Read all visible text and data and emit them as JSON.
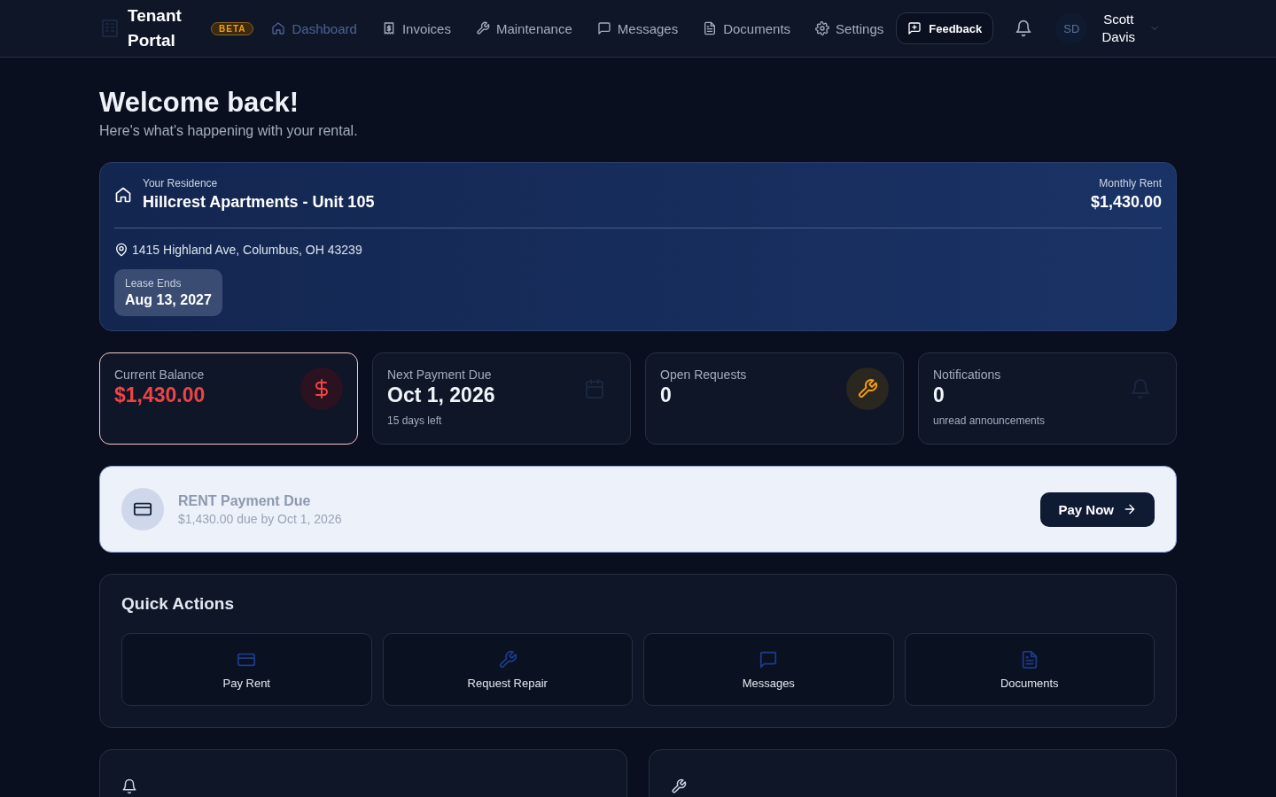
{
  "brand": {
    "title": "Tenant Portal",
    "badge": "BETA"
  },
  "nav": [
    {
      "label": "Dashboard",
      "selected": true
    },
    {
      "label": "Invoices",
      "selected": false
    },
    {
      "label": "Maintenance",
      "selected": false
    },
    {
      "label": "Messages",
      "selected": false
    },
    {
      "label": "Documents",
      "selected": false
    },
    {
      "label": "Settings",
      "selected": false
    }
  ],
  "feedback": "Feedback",
  "user": {
    "initials": "SD",
    "name": "Scott Davis"
  },
  "welcome": {
    "title": "Welcome back!",
    "subtitle": "Here's what's happening with your rental."
  },
  "residence": {
    "label": "Your Residence",
    "name": "Hillcrest Apartments - Unit 105",
    "rent_label": "Monthly Rent",
    "rent": "$1,430.00",
    "address": "1415 Highland Ave, Columbus, OH 43239",
    "lease_label": "Lease Ends",
    "lease_end": "Aug 13, 2027"
  },
  "stats": [
    {
      "label": "Current Balance",
      "value": "$1,430.00",
      "alert": true
    },
    {
      "label": "Next Payment Due",
      "value": "Oct 1, 2026",
      "note": "15 days left",
      "alert": false
    },
    {
      "label": "Open Requests",
      "value": "0",
      "alert": false
    },
    {
      "label": "Notifications",
      "value": "0",
      "note": "unread announcements",
      "alert": false
    }
  ],
  "payment_banner": {
    "title": "RENT Payment Due",
    "detail": "$1,430.00 due by Oct 1, 2026",
    "button": "Pay Now"
  },
  "quick_actions": {
    "title": "Quick Actions",
    "items": [
      {
        "label": "Pay Rent"
      },
      {
        "label": "Request Repair"
      },
      {
        "label": "Messages"
      },
      {
        "label": "Documents"
      }
    ]
  }
}
